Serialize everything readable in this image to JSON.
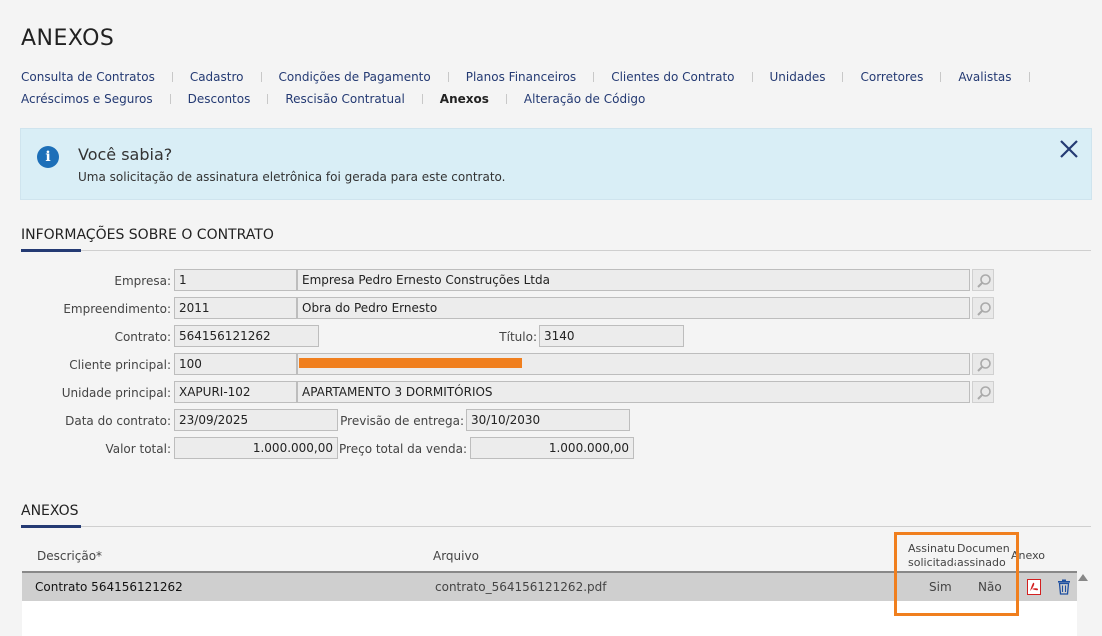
{
  "page": {
    "title": "ANEXOS"
  },
  "nav": {
    "row1": [
      "Consulta de Contratos",
      "Cadastro",
      "Condições de Pagamento",
      "Planos Financeiros",
      "Clientes do Contrato",
      "Unidades",
      "Corretores",
      "Avalistas"
    ],
    "row2": [
      "Acréscimos e Seguros",
      "Descontos",
      "Rescisão Contratual",
      "Anexos",
      "Alteração de Código"
    ],
    "active": "Anexos"
  },
  "info": {
    "title": "Você sabia?",
    "text": "Uma solicitação de assinatura eletrônica foi gerada para este contrato.",
    "icon": "info-icon",
    "close_icon": "close-icon"
  },
  "contract_section": {
    "title": "INFORMAÇÕES SOBRE O CONTRATO",
    "labels": {
      "empresa": "Empresa:",
      "empreendimento": "Empreendimento:",
      "contrato": "Contrato:",
      "titulo": "Título:",
      "cliente": "Cliente principal:",
      "unidade": "Unidade principal:",
      "data": "Data do contrato:",
      "previsao": "Previsão de entrega:",
      "valor": "Valor total:",
      "preco": "Preço total da venda:"
    },
    "values": {
      "empresa_code": "1",
      "empresa_name": "Empresa Pedro Ernesto Construções Ltda",
      "empreendimento_code": "2011",
      "empreendimento_name": "Obra do Pedro Ernesto",
      "contrato": "564156121262",
      "titulo": "3140",
      "cliente_code": "100",
      "cliente_name": "",
      "unidade_code": "XAPURI-102",
      "unidade_name": "APARTAMENTO 3 DORMITÓRIOS",
      "data": "23/09/2025",
      "previsao": "30/10/2030",
      "valor": "1.000.000,00",
      "preco": "1.000.000,00"
    }
  },
  "attachments": {
    "title": "ANEXOS",
    "headers": {
      "descricao": "Descrição*",
      "arquivo": "Arquivo",
      "assinatura_l1": "Assinatura",
      "assinatura_l2": "solicitada",
      "documento_l1": "Documento",
      "documento_l2": "assinado",
      "anexo": "Anexo"
    },
    "rows": [
      {
        "descricao": "Contrato 564156121262",
        "arquivo": "contrato_564156121262.pdf",
        "assinatura": "Sim",
        "documento": "Não"
      }
    ],
    "colors": {
      "highlight": "#f07f1e",
      "pdf": "#d32020",
      "trash": "#1d4fa0"
    }
  }
}
